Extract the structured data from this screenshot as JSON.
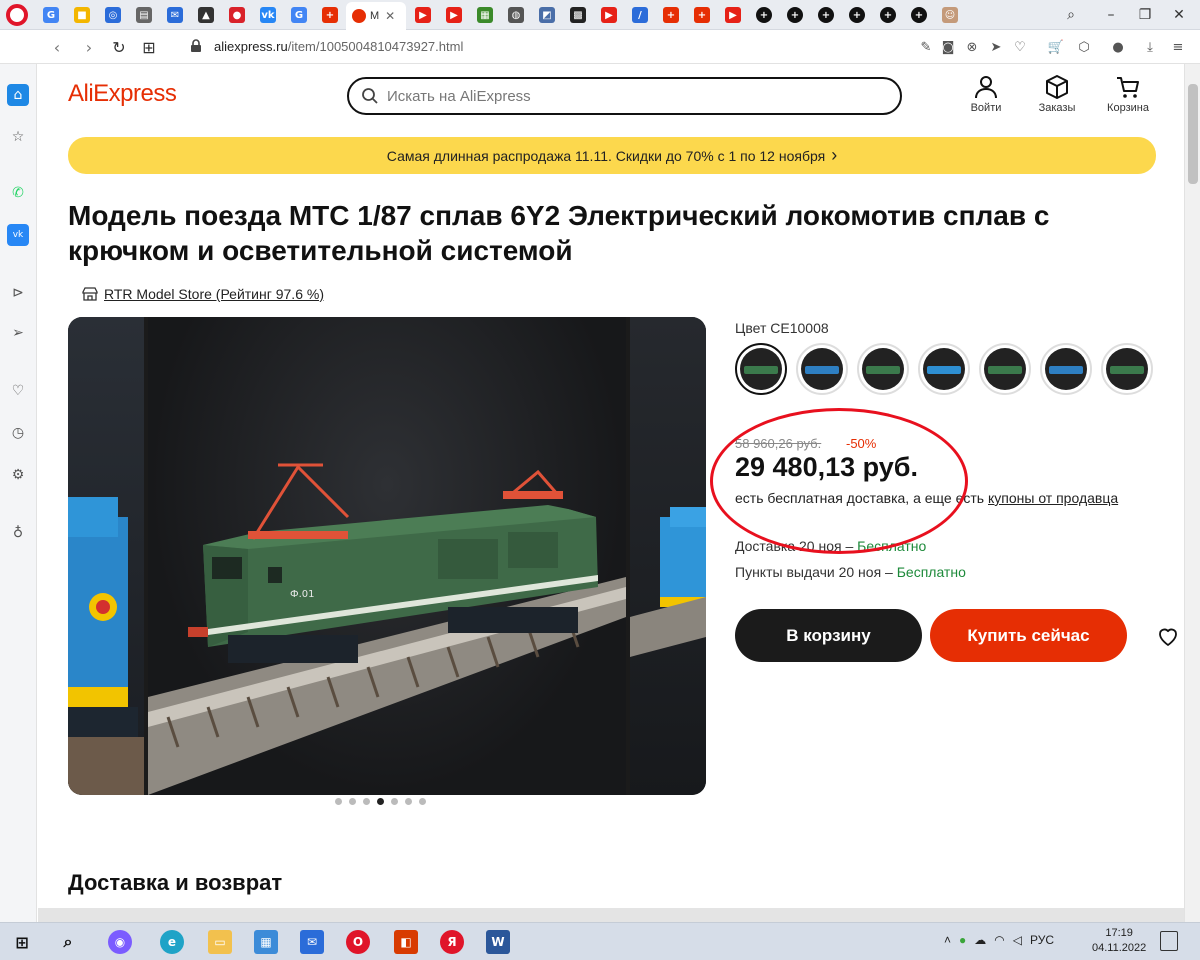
{
  "browser": {
    "tabs": [
      {
        "icon": "google-icon",
        "color": "#4285f4",
        "glyph": "G"
      },
      {
        "icon": "windows-icon",
        "color": "#f3b600",
        "glyph": "■"
      },
      {
        "icon": "globe-icon",
        "color": "#2b6cd9",
        "glyph": "◎"
      },
      {
        "icon": "document-icon",
        "color": "#666666",
        "glyph": "▤"
      },
      {
        "icon": "mail-icon",
        "color": "#2b6cd9",
        "glyph": "✉"
      },
      {
        "icon": "car-icon",
        "color": "#333333",
        "glyph": "▲"
      },
      {
        "icon": "record-icon",
        "color": "#d9222a",
        "glyph": "●"
      },
      {
        "icon": "vk-icon",
        "color": "#2787f5",
        "glyph": "vk"
      },
      {
        "icon": "google-icon",
        "color": "#4285f4",
        "glyph": "G"
      },
      {
        "icon": "aliexpress-icon",
        "color": "#e62e04",
        "glyph": "+"
      }
    ],
    "active_tab": {
      "label": "M",
      "close": "✕"
    },
    "tabs_right": [
      {
        "icon": "youtube-icon",
        "color": "#e62117",
        "glyph": "▶"
      },
      {
        "icon": "youtube-icon",
        "color": "#e62117",
        "glyph": "▶"
      },
      {
        "icon": "image-icon",
        "color": "#3b8a2a",
        "glyph": "▦"
      },
      {
        "icon": "globe-icon",
        "color": "#555555",
        "glyph": "◍"
      },
      {
        "icon": "bookmark-icon",
        "color": "#4a6ea8",
        "glyph": "◩"
      },
      {
        "icon": "chess-icon",
        "color": "#222222",
        "glyph": "▩"
      },
      {
        "icon": "youtube-icon",
        "color": "#e62117",
        "glyph": "▶"
      },
      {
        "icon": "pen-icon",
        "color": "#2b6cd9",
        "glyph": "/"
      },
      {
        "icon": "aliexpress-icon",
        "color": "#e62e04",
        "glyph": "+"
      },
      {
        "icon": "aliexpress-icon",
        "color": "#e62e04",
        "glyph": "+"
      },
      {
        "icon": "youtube-icon",
        "color": "#e62117",
        "glyph": "▶"
      },
      {
        "icon": "plus-circle-icon",
        "color": "#111111",
        "glyph": "+"
      },
      {
        "icon": "plus-circle-icon",
        "color": "#111111",
        "glyph": "+"
      },
      {
        "icon": "plus-circle-icon",
        "color": "#111111",
        "glyph": "+"
      },
      {
        "icon": "plus-circle-icon",
        "color": "#111111",
        "glyph": "+"
      },
      {
        "icon": "plus-circle-icon",
        "color": "#111111",
        "glyph": "+"
      },
      {
        "icon": "plus-circle-icon",
        "color": "#111111",
        "glyph": "+"
      },
      {
        "icon": "profile-icon",
        "color": "#c49a7a",
        "glyph": "☺"
      }
    ],
    "url_host": "aliexpress.ru",
    "url_path": "/item/1005004810473927.html"
  },
  "header": {
    "logo": "AliExpress",
    "search_placeholder": "Искать на AliExpress",
    "login": "Войти",
    "orders": "Заказы",
    "cart": "Корзина"
  },
  "promo": {
    "text": "Самая длинная распродажа 11.11. Скидки до 70% с 1 по 12 ноября",
    "chevron": "›"
  },
  "product": {
    "title": "Модель поезда MTC 1/87 сплав 6Y2 Электрический локомотив сплав с крючком и осветительной системой",
    "store": "RTR Model Store (Рейтинг 97.6 %)",
    "color_label": "Цвет CE10008",
    "swatches": [
      {
        "loco": "#3b7a4c",
        "active": true
      },
      {
        "loco": "#2e7fc2"
      },
      {
        "loco": "#3b7a4c"
      },
      {
        "loco": "#2e8fd2"
      },
      {
        "loco": "#3b7a4c"
      },
      {
        "loco": "#2e7fc2"
      },
      {
        "loco": "#3b7a4c"
      }
    ],
    "old_price": "58 960,26 руб.",
    "discount": "-50%",
    "price": "29 480,13 руб.",
    "delivery_note_prefix": "есть бесплатная доставка, а еще есть ",
    "delivery_note_link": "купоны от продавца",
    "delivery_line1_prefix": "Доставка 20 ноя – ",
    "delivery_line2_prefix": "Пункты выдачи 20 ноя – ",
    "free": "Бесплатно",
    "btn_cart": "В корзину",
    "btn_buy": "Купить сейчас",
    "gallery_dots": 7,
    "gallery_active_dot": 4
  },
  "section": {
    "title": "Доставка и возврат"
  },
  "taskbar": {
    "lang": "РУС",
    "time": "17:19",
    "date": "04.11.2022"
  }
}
